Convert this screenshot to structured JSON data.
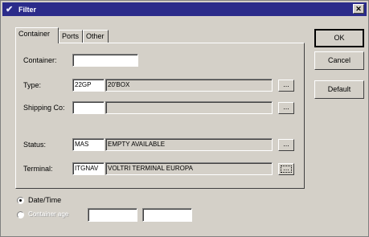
{
  "window": {
    "title": "Filter",
    "close_glyph": "✕"
  },
  "tabs": [
    {
      "label": "Container",
      "active": true
    },
    {
      "label": "Ports",
      "active": false
    },
    {
      "label": "Other",
      "active": false
    }
  ],
  "form": {
    "container": {
      "label": "Container:",
      "value": ""
    },
    "type": {
      "label": "Type:",
      "code": "22GP",
      "description": "20'BOX"
    },
    "shipping_co": {
      "label": "Shipping Co:",
      "code": "",
      "description": ""
    },
    "status": {
      "label": "Status:",
      "code": "MAS",
      "description": "EMPTY AVAILABLE"
    },
    "terminal": {
      "label": "Terminal:",
      "code": "ITGNAV",
      "description": "VOLTRI TERMINAL EUROPA"
    },
    "ellipsis_label": "..."
  },
  "buttons": {
    "ok": "OK",
    "cancel": "Cancel",
    "default": "Default"
  },
  "date_options": {
    "date_time_label": "Date/Time",
    "other_label": "Container age",
    "from_value": "",
    "to_value": ""
  },
  "colors": {
    "titlebar": "#2b2b8a",
    "face": "#d4d0c8"
  }
}
